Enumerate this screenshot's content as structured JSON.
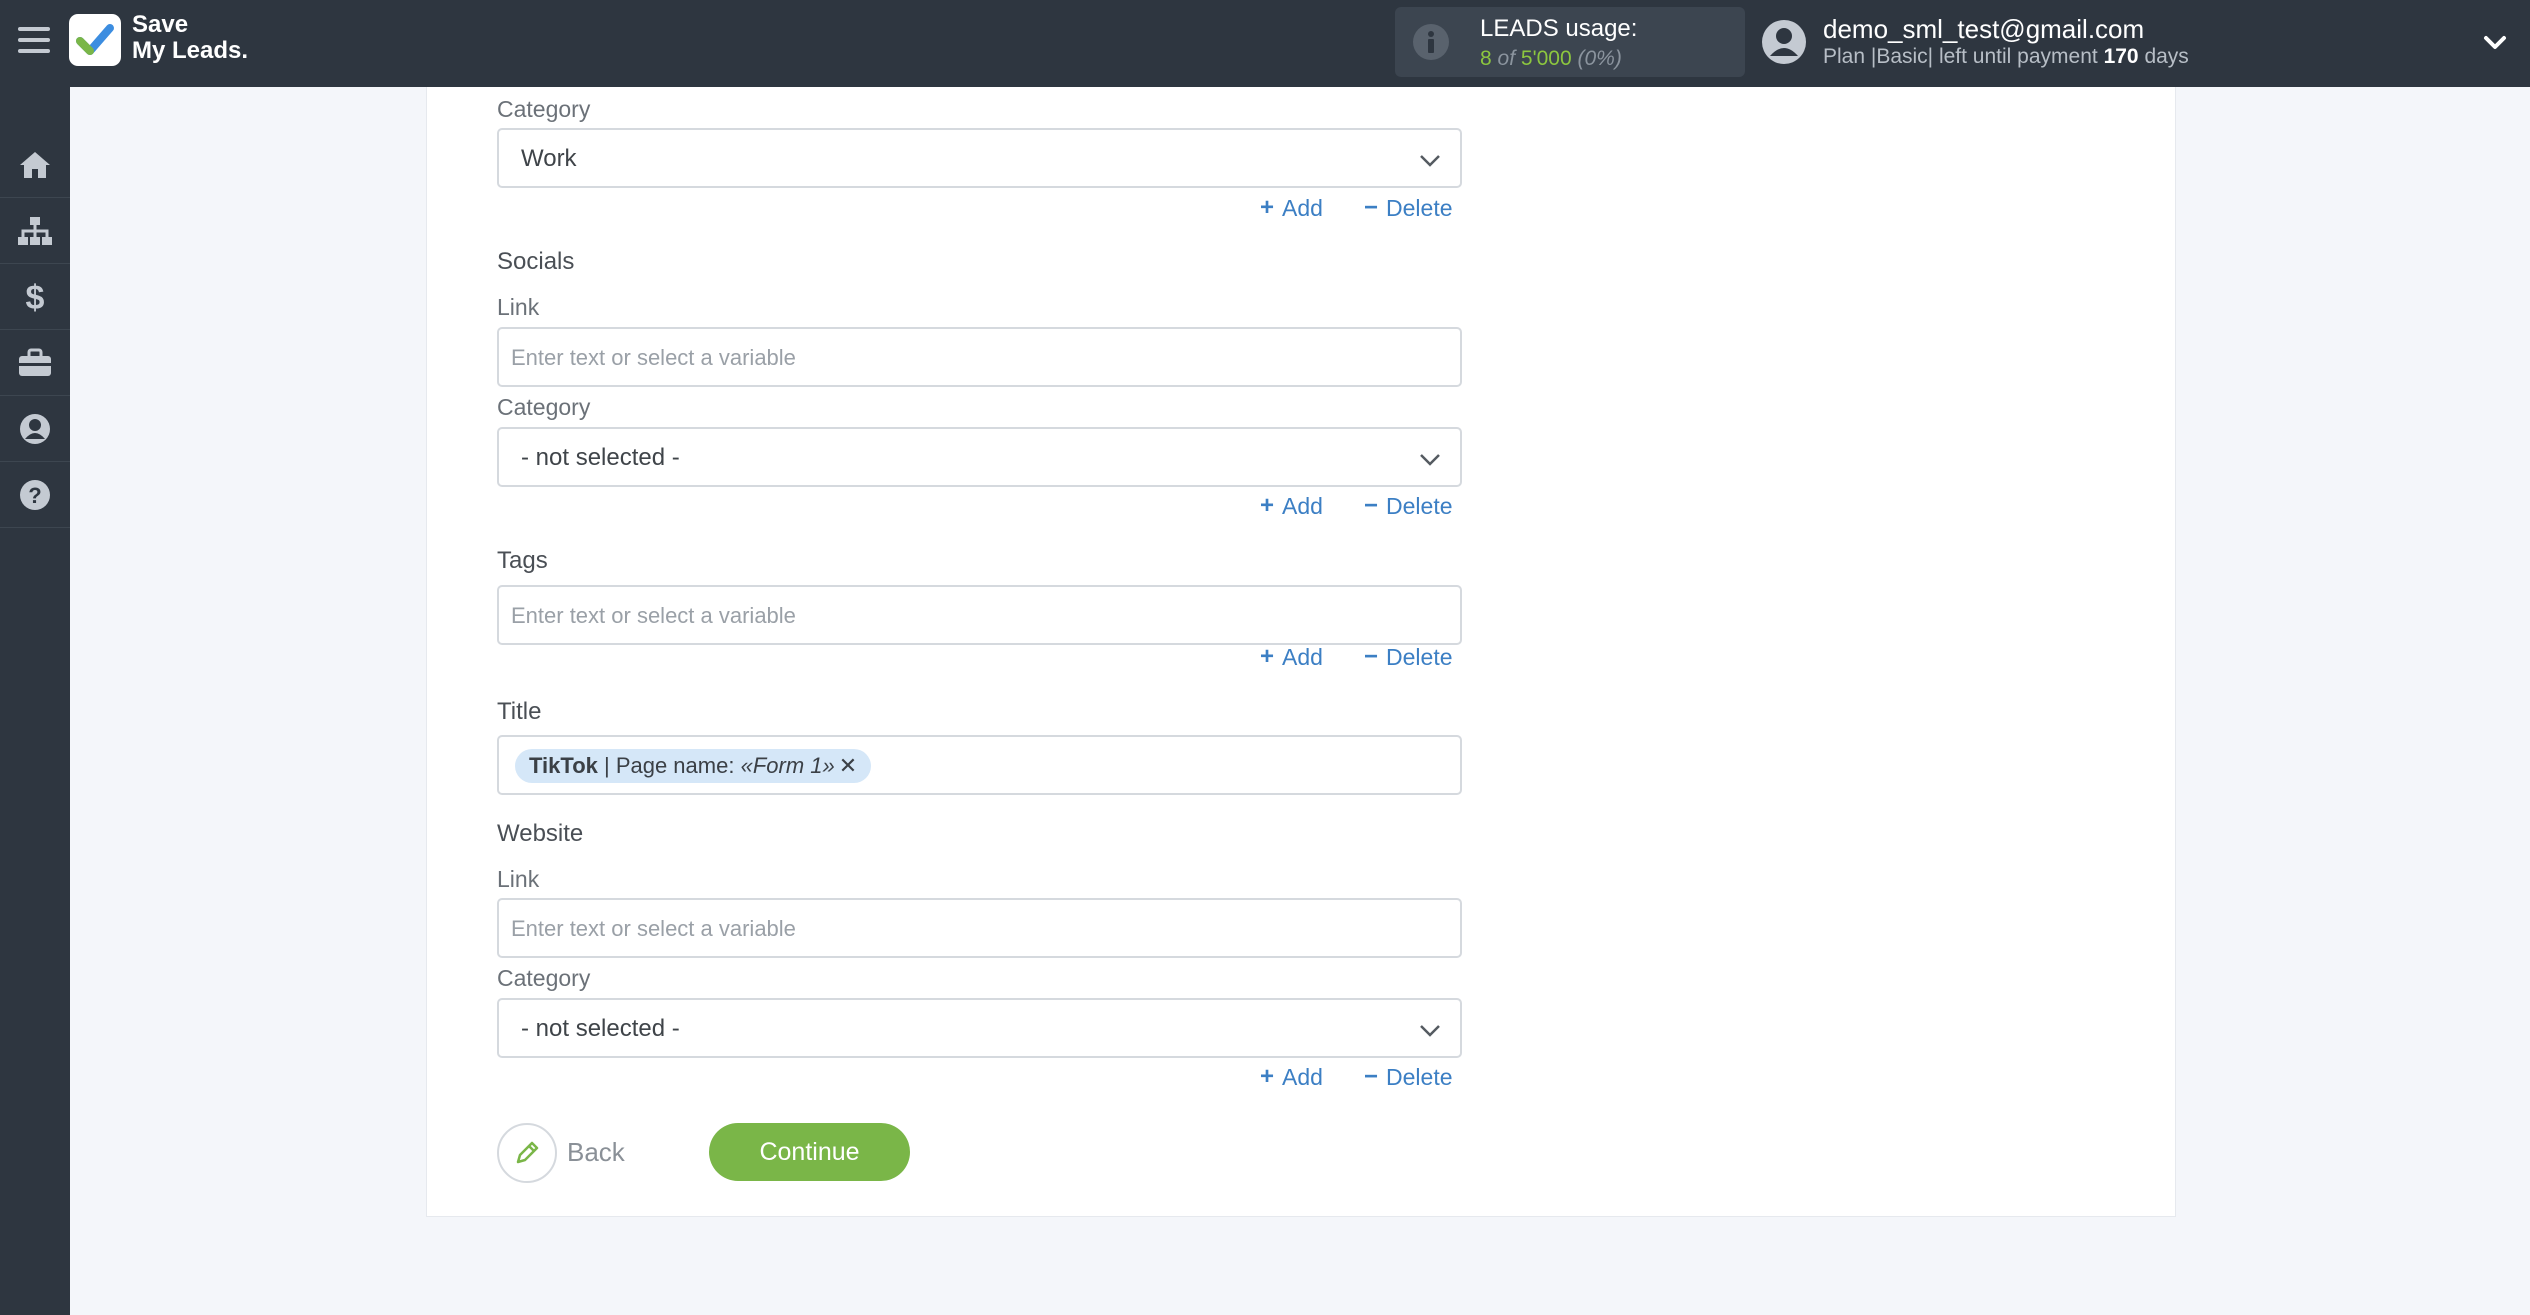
{
  "header": {
    "logo_line1": "Save",
    "logo_line2": "My Leads.",
    "usage_title": "LEADS usage:",
    "usage_used": "8",
    "usage_of": "of",
    "usage_total": "5'000",
    "usage_pct": "(0%)",
    "user_email": "demo_sml_test@gmail.com",
    "plan_prefix": "Plan |Basic| left until payment",
    "plan_days": "170",
    "plan_suffix": "days"
  },
  "sidebar": {
    "items": [
      "home-icon",
      "sitemap-icon",
      "dollar-icon",
      "briefcase-icon",
      "user-icon",
      "help-icon"
    ]
  },
  "form": {
    "category1_label": "Category",
    "category1_value": "Work",
    "socials_title": "Socials",
    "socials_link_label": "Link",
    "socials_link_placeholder": "Enter text or select a variable",
    "socials_category_label": "Category",
    "socials_category_value": "- not selected -",
    "tags_title": "Tags",
    "tags_placeholder": "Enter text or select a variable",
    "title_title": "Title",
    "title_chip_source": "TikTok",
    "title_chip_middle": " | Page name: ",
    "title_chip_var": "«Form 1»",
    "title_chip_x": "✕",
    "website_title": "Website",
    "website_link_label": "Link",
    "website_link_placeholder": "Enter text or select a variable",
    "website_category_label": "Category",
    "website_category_value": "- not selected -",
    "add_label": "Add",
    "delete_label": "Delete",
    "add_symbol": "+",
    "delete_symbol": "−"
  },
  "buttons": {
    "back": "Back",
    "continue": "Continue"
  },
  "colors": {
    "topbar": "#2e3640",
    "accent_green": "#7ab648",
    "link_blue": "#3c7fc4",
    "chip_bg": "#d5e7f8"
  }
}
